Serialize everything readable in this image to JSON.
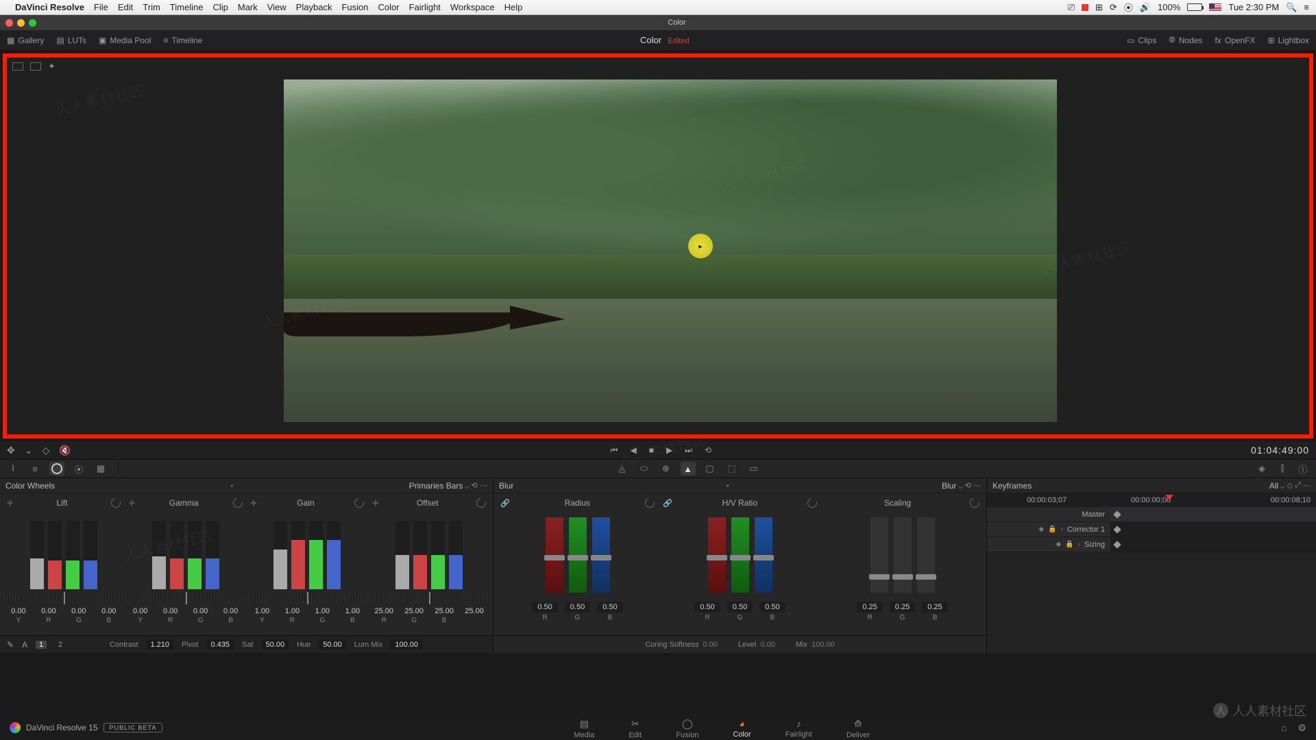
{
  "menubar": {
    "app": "DaVinci Resolve",
    "items": [
      "File",
      "Edit",
      "Trim",
      "Timeline",
      "Clip",
      "Mark",
      "View",
      "Playback",
      "Fusion",
      "Color",
      "Fairlight",
      "Workspace",
      "Help"
    ],
    "battery_pct": "100%",
    "clock": "Tue 2:30 PM"
  },
  "titlebar": {
    "title": "Color"
  },
  "pagetool": {
    "left": [
      {
        "icon": "gallery-icon",
        "label": "Gallery"
      },
      {
        "icon": "luts-icon",
        "label": "LUTs"
      },
      {
        "icon": "mediapool-icon",
        "label": "Media Pool"
      },
      {
        "icon": "timeline-icon",
        "label": "Timeline"
      }
    ],
    "title": "Color",
    "edited": "Edited",
    "right": [
      {
        "icon": "clips-icon",
        "label": "Clips"
      },
      {
        "icon": "nodes-icon",
        "label": "Nodes"
      },
      {
        "icon": "openfx-icon",
        "label": "OpenFX"
      },
      {
        "icon": "lightbox-icon",
        "label": "Lightbox"
      }
    ]
  },
  "transport": {
    "timecode": "01:04:49:00"
  },
  "colorwheels": {
    "title": "Color Wheels",
    "mode": "Primaries Bars",
    "columns": [
      {
        "name": "Lift",
        "vals": [
          "0.00",
          "0.00",
          "0.00",
          "0.00"
        ],
        "labels": [
          "Y",
          "R",
          "G",
          "B"
        ]
      },
      {
        "name": "Gamma",
        "vals": [
          "0.00",
          "0.00",
          "0.00",
          "0.00"
        ],
        "labels": [
          "Y",
          "R",
          "G",
          "B"
        ]
      },
      {
        "name": "Gain",
        "vals": [
          "1.00",
          "1.00",
          "1.00",
          "1.00"
        ],
        "labels": [
          "Y",
          "R",
          "G",
          "B"
        ]
      },
      {
        "name": "Offset",
        "vals": [
          "25.00",
          "25.00",
          "25.00",
          "25.00"
        ],
        "labels": [
          "R",
          "G",
          "B",
          ""
        ]
      }
    ],
    "globals": {
      "pages": [
        "1",
        "2"
      ],
      "contrast_lbl": "Contrast",
      "contrast": "1.210",
      "pivot_lbl": "Pivot",
      "pivot": "0.435",
      "sat_lbl": "Sat",
      "sat": "50.00",
      "hue_lbl": "Hue",
      "hue": "50.00",
      "lummix_lbl": "Lum Mix",
      "lummix": "100.00"
    }
  },
  "blur": {
    "title": "Blur",
    "mode": "Blur",
    "columns": [
      {
        "name": "Radius",
        "link": true,
        "vals": [
          "0.50",
          "0.50",
          "0.50"
        ],
        "labels": [
          "R",
          "G",
          "B"
        ],
        "handle_pct": 50,
        "colored": true
      },
      {
        "name": "H/V Ratio",
        "link": true,
        "vals": [
          "0.50",
          "0.50",
          "0.50"
        ],
        "labels": [
          "R",
          "G",
          "B"
        ],
        "handle_pct": 50,
        "colored": true
      },
      {
        "name": "Scaling",
        "link": false,
        "vals": [
          "0.25",
          "0.25",
          "0.25"
        ],
        "labels": [
          "R",
          "G",
          "B"
        ],
        "handle_pct": 75,
        "colored": false
      }
    ],
    "globals": {
      "coring_lbl": "Coring Softness",
      "coring": "0.00",
      "level_lbl": "Level",
      "level": "0.00",
      "mix_lbl": "Mix",
      "mix": "100.00"
    }
  },
  "keyframes": {
    "title": "Keyframes",
    "filter": "All",
    "playhead_tc": "00:00:03;07",
    "start_tc": "00:00:00;00",
    "end_tc": "00:00:08;10",
    "rows": [
      {
        "name": "Master",
        "master": true
      },
      {
        "name": "Corrector 1",
        "master": false
      },
      {
        "name": "Sizing",
        "master": false
      }
    ]
  },
  "pagetabs": {
    "version": "DaVinci Resolve 15",
    "badge": "PUBLIC BETA",
    "tabs": [
      {
        "name": "Media",
        "icon": "▤"
      },
      {
        "name": "Edit",
        "icon": "✂"
      },
      {
        "name": "Fusion",
        "icon": "◯"
      },
      {
        "name": "Color",
        "icon": "◕",
        "active": true
      },
      {
        "name": "Fairlight",
        "icon": "♪"
      },
      {
        "name": "Deliver",
        "icon": "⟰"
      }
    ]
  },
  "watermark": "人人素材社区"
}
